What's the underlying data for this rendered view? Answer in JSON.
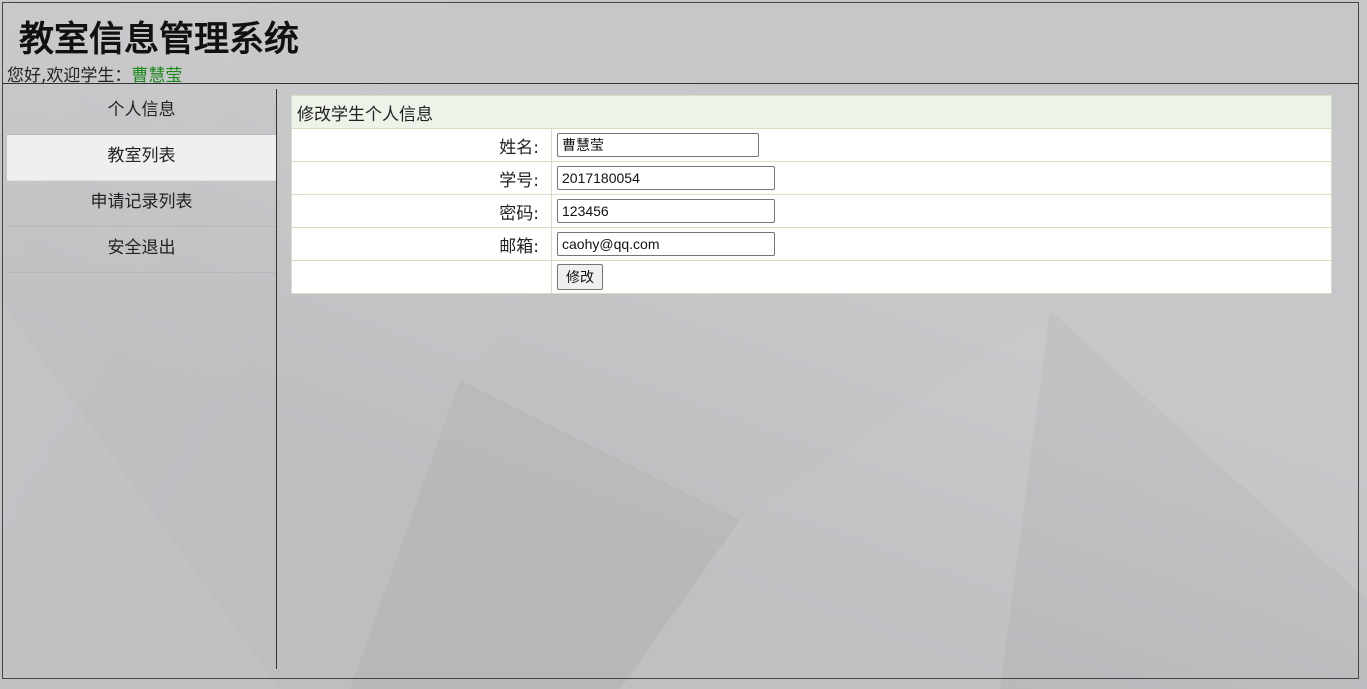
{
  "header": {
    "title": "教室信息管理系统",
    "welcome_prefix": "您好,欢迎学生：",
    "user_name": "曹慧莹"
  },
  "sidebar": {
    "items": [
      {
        "label": "个人信息"
      },
      {
        "label": "教室列表"
      },
      {
        "label": "申请记录列表"
      },
      {
        "label": "安全退出"
      }
    ]
  },
  "form": {
    "caption": "修改学生个人信息",
    "fields": [
      {
        "label": "姓名:",
        "value": "曹慧莹"
      },
      {
        "label": "学号:",
        "value": "2017180054"
      },
      {
        "label": "密码:",
        "value": "123456"
      },
      {
        "label": "邮箱:",
        "value": "caohy@qq.com"
      }
    ],
    "submit_label": "修改"
  }
}
